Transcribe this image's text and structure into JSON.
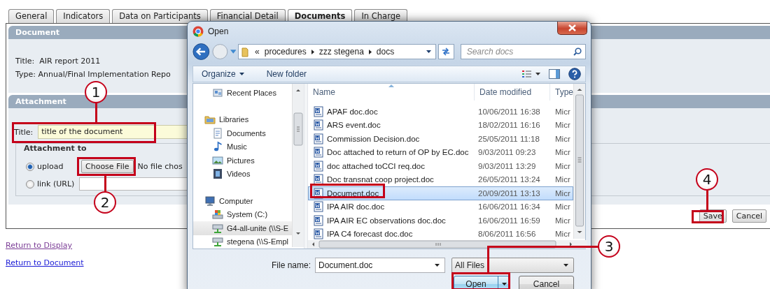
{
  "tabs": [
    {
      "label": "General",
      "selected": false
    },
    {
      "label": "Indicators",
      "selected": false
    },
    {
      "label": "Data on Participants",
      "selected": false
    },
    {
      "label": "Financial Detail",
      "selected": false
    },
    {
      "label": "Documents",
      "selected": true
    },
    {
      "label": "In Charge",
      "selected": false
    }
  ],
  "document_section": {
    "heading": "Document",
    "lines": [
      "Title:  AIR report 2011",
      "Type: Annual/Final Implementation Repo"
    ]
  },
  "attachment_section": {
    "heading": "Attachment",
    "title_label": "Title:",
    "title_value": "title of the document",
    "group_label": "Attachment to",
    "options": [
      {
        "label": "upload",
        "kind": "upload",
        "selected": true
      },
      {
        "label": "link (URL)",
        "kind": "link",
        "selected": false
      }
    ],
    "choose_file_button": "Choose File",
    "file_status": "No file chos"
  },
  "form_buttons": [
    "Save",
    "Cancel"
  ],
  "links": [
    {
      "label": "Return to Display",
      "visited": true
    },
    {
      "label": "Return to Document",
      "visited": false
    }
  ],
  "open_dialog": {
    "title": "Open",
    "path": [
      "«",
      "procedures",
      "zzz stegena",
      "docs"
    ],
    "search_placeholder": "Search docs",
    "toolbar": [
      {
        "label": "Organize",
        "kind": "menu"
      },
      {
        "label": "New folder",
        "kind": "command"
      }
    ],
    "nav": [
      {
        "label": "Recent Places",
        "kind": "recent",
        "selected": false
      },
      {
        "label": "Libraries",
        "kind": "library",
        "selected": false,
        "children": [
          {
            "label": "Documents",
            "kind": "documents",
            "selected": false
          },
          {
            "label": "Music",
            "kind": "music",
            "selected": false
          },
          {
            "label": "Pictures",
            "kind": "pictures",
            "selected": false
          },
          {
            "label": "Videos",
            "kind": "videos",
            "selected": false
          }
        ]
      },
      {
        "label": "Computer",
        "kind": "computer",
        "selected": false,
        "children": [
          {
            "label": "System (C:)",
            "kind": "drive",
            "selected": false
          },
          {
            "label": "G4-all-unite (\\\\S-E",
            "kind": "network",
            "selected": true
          },
          {
            "label": "stegena (\\\\S-Empl",
            "kind": "network",
            "selected": false
          }
        ]
      }
    ],
    "columns": [
      "Name",
      "Date modified",
      "Type"
    ],
    "files": [
      {
        "name": "APAF doc.doc",
        "date": "10/06/2011 16:38",
        "type": "Micr",
        "selected": false
      },
      {
        "name": "ARS event.doc",
        "date": "18/02/2011 16:16",
        "type": "Micr",
        "selected": false
      },
      {
        "name": "Commission Decision.doc",
        "date": "25/05/2011 11:18",
        "type": "Micr",
        "selected": false
      },
      {
        "name": "Doc attached to return of OP by EC.doc",
        "date": "9/03/2011 09:23",
        "type": "Micr",
        "selected": false
      },
      {
        "name": "doc attached toCCI req.doc",
        "date": "9/03/2011 13:29",
        "type": "Micr",
        "selected": false
      },
      {
        "name": "Doc transnat coop project.doc",
        "date": "26/05/2011 13:24",
        "type": "Micr",
        "selected": false
      },
      {
        "name": "Document.doc",
        "date": "20/09/2011 13:13",
        "type": "Micr",
        "selected": true
      },
      {
        "name": "IPA AIR doc.doc",
        "date": "16/06/2011 16:34",
        "type": "Micr",
        "selected": false
      },
      {
        "name": "IPA AIR EC observations doc.doc",
        "date": "16/06/2011 16:59",
        "type": "Micr",
        "selected": false
      },
      {
        "name": "IPA C4 forecast doc.doc",
        "date": "8/06/2011 16:56",
        "type": "Micr",
        "selected": false
      }
    ],
    "file_name_label": "File name:",
    "file_name": "Document.doc",
    "filter": "All Files",
    "buttons": [
      {
        "label": "Open",
        "kind": "split"
      },
      {
        "label": "Cancel",
        "kind": "plain"
      }
    ]
  },
  "callouts": [
    "1",
    "2",
    "3",
    "4"
  ]
}
